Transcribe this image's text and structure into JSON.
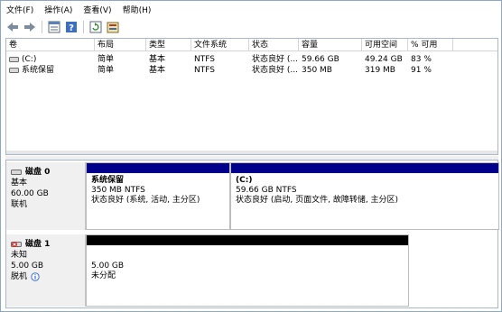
{
  "menu": {
    "file": "文件(F)",
    "action": "操作(A)",
    "view": "查看(V)",
    "help": "帮助(H)"
  },
  "toolbar_icons": [
    "back-arrow-icon",
    "forward-arrow-icon",
    "properties-icon",
    "help-icon",
    "refresh-icon",
    "rescan-icon"
  ],
  "volume_list": {
    "columns": [
      "卷",
      "布局",
      "类型",
      "文件系统",
      "状态",
      "容量",
      "可用空间",
      "% 可用"
    ],
    "rows": [
      [
        "(C:)",
        "简单",
        "基本",
        "NTFS",
        "状态良好 (...",
        "59.66 GB",
        "49.24 GB",
        "83 %"
      ],
      [
        "系统保留",
        "简单",
        "基本",
        "NTFS",
        "状态良好 (...",
        "350 MB",
        "319 MB",
        "91 %"
      ]
    ]
  },
  "disks": [
    {
      "name": "磁盘 0",
      "type": "基本",
      "size": "60.00 GB",
      "state": "联机",
      "partitions": [
        {
          "name": "系统保留",
          "size_fs": "350 MB NTFS",
          "status": "状态良好 (系统, 活动, 主分区)"
        },
        {
          "name": "(C:)",
          "size_fs": "59.66 GB NTFS",
          "status": "状态良好 (启动, 页面文件, 故障转储, 主分区)"
        }
      ]
    },
    {
      "name": "磁盘 1",
      "type": "未知",
      "size": "5.00 GB",
      "state": "脱机",
      "partitions": [
        {
          "size": "5.00 GB",
          "status": "未分配"
        }
      ]
    }
  ],
  "colors": {
    "primary_partition": "#00008b",
    "unallocated": "#000000",
    "panel_bg": "#f0f0f0"
  }
}
